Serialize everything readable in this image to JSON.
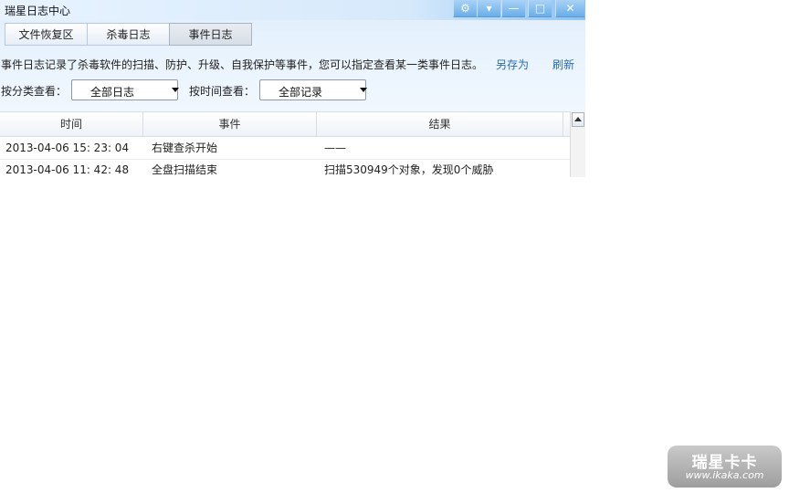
{
  "window": {
    "title": "瑞星日志中心",
    "controls": [
      {
        "name": "settings-icon",
        "glyph": "⚙"
      },
      {
        "name": "menu-icon",
        "glyph": "▾"
      },
      {
        "name": "minimize-icon",
        "glyph": "—"
      },
      {
        "name": "maximize-icon",
        "glyph": "□"
      },
      {
        "name": "close-icon",
        "glyph": "✕"
      }
    ]
  },
  "tabs": [
    {
      "label": "文件恢复区",
      "active": false
    },
    {
      "label": "杀毒日志",
      "active": false
    },
    {
      "label": "事件日志",
      "active": true
    }
  ],
  "description": "事件日志记录了杀毒软件的扫描、防护、升级、自我保护等事件，您可以指定查看某一类事件日志。",
  "actions": {
    "save_as": "另存为",
    "refresh": "刷新"
  },
  "filters": {
    "category_label": "按分类查看：",
    "category_value": "全部日志",
    "time_label": "按时间查看：",
    "time_value": "全部记录"
  },
  "table": {
    "columns": [
      "时间",
      "事件",
      "结果"
    ],
    "rows": [
      [
        "2013-04-06 15: 23: 04",
        "右键查杀开始",
        "——"
      ],
      [
        "2013-04-06 11: 42: 48",
        "全盘扫描结束",
        "扫描530949个对象，发现0个威胁"
      ]
    ]
  },
  "watermark": {
    "brand": "瑞星卡卡",
    "url": "www.ikaka.com"
  },
  "colors": {
    "accent": "#6aaee9",
    "link": "#2a6bb0"
  }
}
